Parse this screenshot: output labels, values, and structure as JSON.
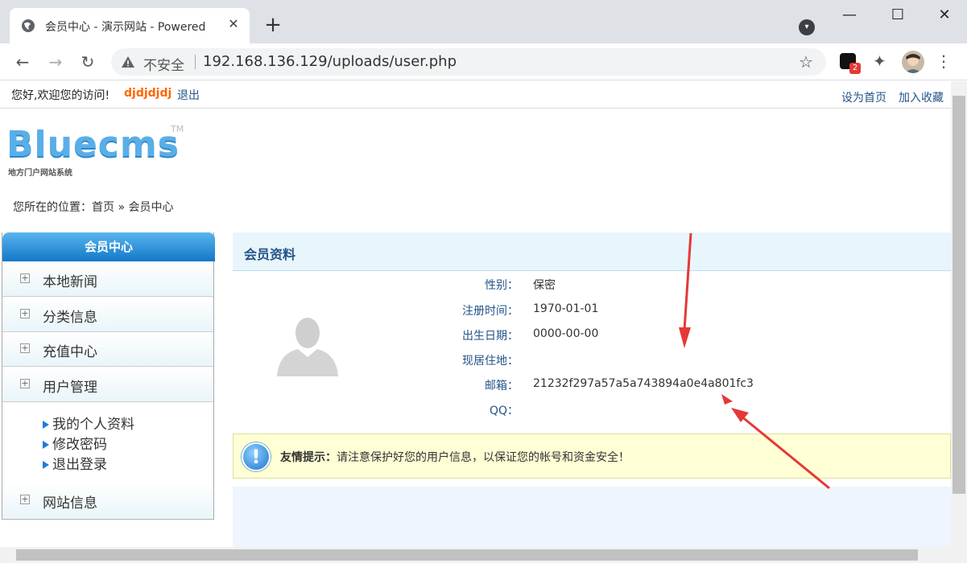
{
  "browser": {
    "tab_title": "会员中心 - 演示网站 - Powered",
    "address_insecure": "不安全",
    "address_url": "192.168.136.129/uploads/user.php",
    "ext_badge": "2"
  },
  "topbar": {
    "greeting": "您好,欢迎您的访问!",
    "username": "djdjdjdj",
    "logout": "退出",
    "set_home": "设为首页",
    "add_fav": "加入收藏"
  },
  "logo": {
    "name": "Bluecms",
    "tm": "TM",
    "tagline": "地方门户网站系统"
  },
  "breadcrumb": "您所在的位置：首页 » 会员中心",
  "sidebar": {
    "title": "会员中心",
    "items": [
      {
        "label": "本地新闻"
      },
      {
        "label": "分类信息"
      },
      {
        "label": "充值中心"
      },
      {
        "label": "用户管理"
      },
      {
        "label": "网站信息"
      }
    ],
    "sub_items": [
      {
        "label": "我的个人资料"
      },
      {
        "label": "修改密码"
      },
      {
        "label": "退出登录"
      }
    ]
  },
  "main": {
    "title": "会员资料",
    "fields": [
      {
        "label": "性别：",
        "value": "保密"
      },
      {
        "label": "注册时间：",
        "value": "1970-01-01"
      },
      {
        "label": "出生日期：",
        "value": "0000-00-00"
      },
      {
        "label": "现居住地：",
        "value": ""
      },
      {
        "label": "邮箱：",
        "value": "21232f297a57a5a743894a0e4a801fc3"
      },
      {
        "label": "QQ：",
        "value": ""
      }
    ],
    "tip_label": "友情提示：",
    "tip_text": "请注意保护好您的用户信息，以保证您的帐号和资金安全！"
  },
  "colors": {
    "accent": "#1278c8",
    "link": "#245488",
    "username": "#ff6600",
    "annotation": "#e53935"
  }
}
